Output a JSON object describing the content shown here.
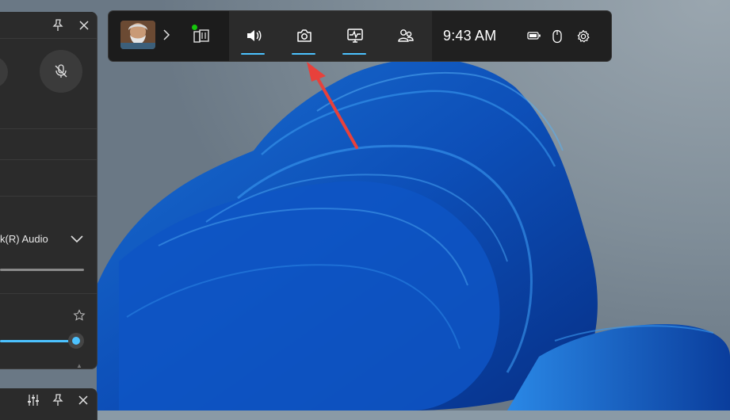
{
  "gamebar": {
    "time": "9:43 AM",
    "widgets": [
      {
        "name": "Audio",
        "icon": "speaker-icon",
        "active": true
      },
      {
        "name": "Capture",
        "icon": "camera-icon",
        "active": true
      },
      {
        "name": "Performance",
        "icon": "performance-monitor-icon",
        "active": true
      },
      {
        "name": "Social",
        "icon": "people-icon",
        "active": false
      }
    ],
    "status_icons": [
      "battery-icon",
      "mouse-icon",
      "gear-icon"
    ],
    "accent_color": "#4cc2ff"
  },
  "audio_widget": {
    "device_label": "k(R) Audio",
    "mic_muted": true,
    "volume": 0.9
  },
  "annotation": {
    "arrow_color": "#e8413b",
    "points_to": "Capture"
  }
}
